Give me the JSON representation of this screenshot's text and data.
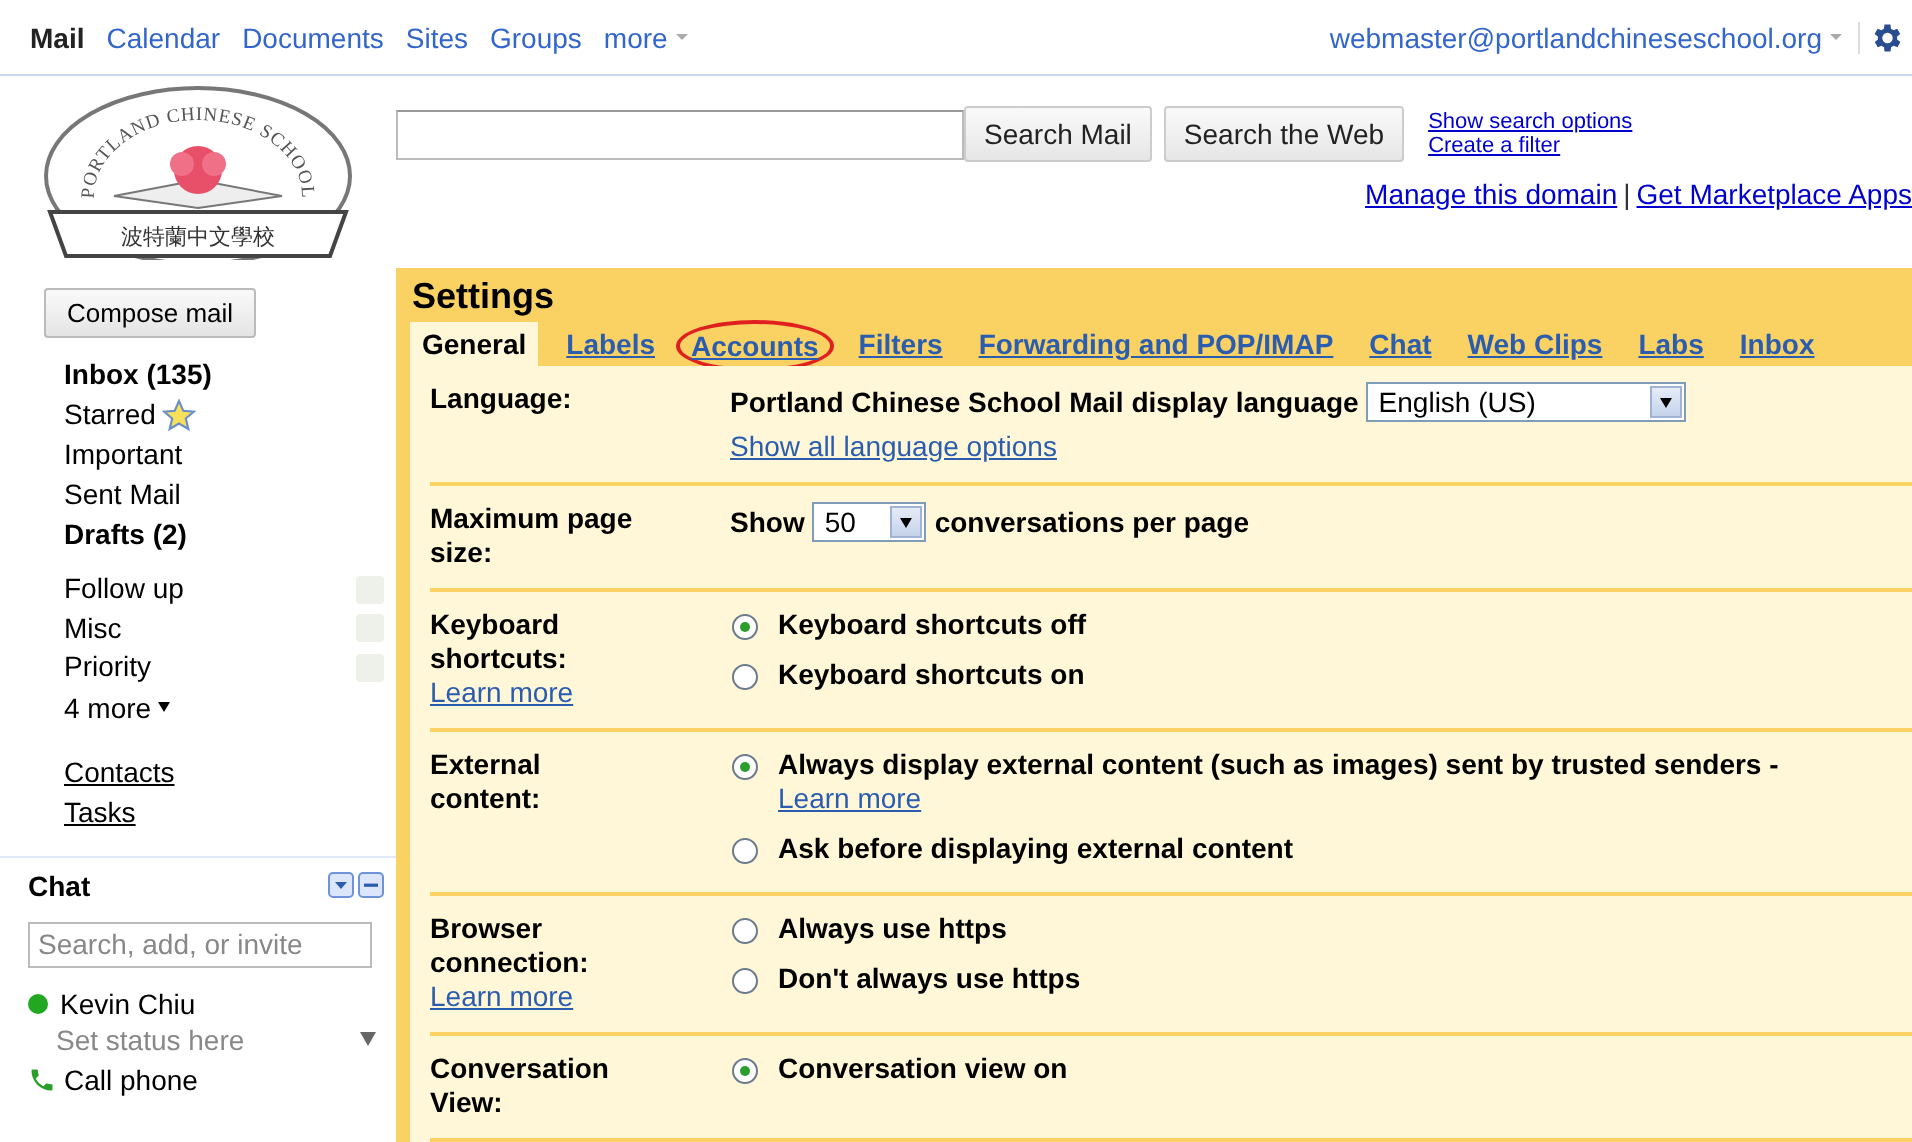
{
  "top_nav": {
    "items": [
      {
        "label": "Mail",
        "selected": true
      },
      {
        "label": "Calendar",
        "selected": false
      },
      {
        "label": "Documents",
        "selected": false
      },
      {
        "label": "Sites",
        "selected": false
      },
      {
        "label": "Groups",
        "selected": false
      },
      {
        "label": "more",
        "selected": false
      }
    ],
    "account": "webmaster@portlandchineseschool.org"
  },
  "logo": {
    "arc_text": "PORTLAND CHINESE SCHOOL",
    "ribbon_text": "波特蘭中文學校"
  },
  "search": {
    "buttons": [
      "Search Mail",
      "Search the Web"
    ],
    "links": [
      "Show search options",
      "Create a filter"
    ],
    "admin_links": [
      "Manage this domain",
      "Get Marketplace Apps"
    ],
    "admin_separator": "|"
  },
  "sidebar": {
    "compose": "Compose mail",
    "folders": [
      {
        "label": "Inbox (135)",
        "bold": true,
        "starred": false
      },
      {
        "label": "Starred",
        "bold": false,
        "starred": true
      },
      {
        "label": "Important",
        "bold": false,
        "starred": false
      },
      {
        "label": "Sent Mail",
        "bold": false,
        "starred": false
      },
      {
        "label": "Drafts (2)",
        "bold": true,
        "starred": false
      }
    ],
    "labels": [
      {
        "label": "Follow up"
      },
      {
        "label": "Misc"
      },
      {
        "label": "Priority"
      }
    ],
    "more": "4 more",
    "links": [
      "Contacts",
      "Tasks"
    ],
    "chat": {
      "title": "Chat",
      "placeholder": "Search, add, or invite",
      "user": "Kevin Chiu",
      "status_placeholder": "Set status here",
      "call": "Call phone"
    }
  },
  "settings": {
    "title": "Settings",
    "tabs": [
      {
        "label": "General",
        "selected": true,
        "circled": false
      },
      {
        "label": "Labels",
        "selected": false,
        "circled": false
      },
      {
        "label": "Accounts",
        "selected": false,
        "circled": true
      },
      {
        "label": "Filters",
        "selected": false,
        "circled": false
      },
      {
        "label": "Forwarding and POP/IMAP",
        "selected": false,
        "circled": false
      },
      {
        "label": "Chat",
        "selected": false,
        "circled": false
      },
      {
        "label": "Web Clips",
        "selected": false,
        "circled": false
      },
      {
        "label": "Labs",
        "selected": false,
        "circled": false
      },
      {
        "label": "Inbox",
        "selected": false,
        "circled": false
      }
    ],
    "rows": [
      {
        "label": "Language:",
        "kind": "language",
        "text": "Portland Chinese School Mail display language",
        "value": "English (US)",
        "link": "Show all language options"
      },
      {
        "label": "Maximum page size:",
        "kind": "pagesize",
        "before": "Show",
        "value": "50",
        "after": "conversations per page"
      },
      {
        "label": "Keyboard shortcuts:",
        "learn_more": "Learn more",
        "kind": "radios",
        "options": [
          {
            "label": "Keyboard shortcuts off",
            "selected": true
          },
          {
            "label": "Keyboard shortcuts on",
            "selected": false
          }
        ]
      },
      {
        "label": "External content:",
        "kind": "radios",
        "options": [
          {
            "label": "Always display external content (such as images) sent by trusted senders -",
            "link": "Learn more",
            "selected": true
          },
          {
            "label": "Ask before displaying external content",
            "selected": false
          }
        ]
      },
      {
        "label": "Browser connection:",
        "learn_more": "Learn more",
        "kind": "radios",
        "options": [
          {
            "label": "Always use https",
            "selected": false
          },
          {
            "label": "Don't always use https",
            "selected": false
          }
        ]
      },
      {
        "label": "Conversation View:",
        "kind": "radios",
        "options": [
          {
            "label": "Conversation view on",
            "selected": true
          }
        ]
      }
    ]
  }
}
